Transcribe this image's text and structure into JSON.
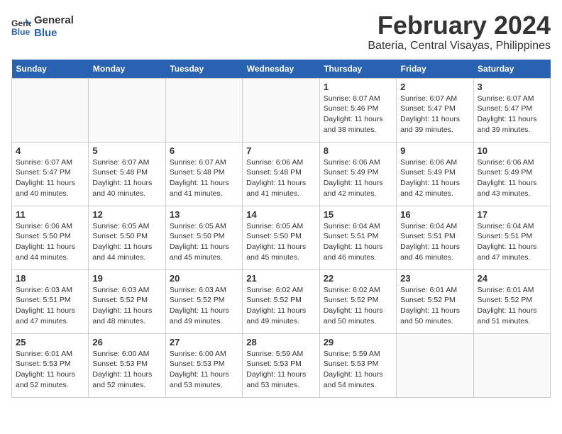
{
  "header": {
    "logo_line1": "General",
    "logo_line2": "Blue",
    "month": "February 2024",
    "location": "Bateria, Central Visayas, Philippines"
  },
  "weekdays": [
    "Sunday",
    "Monday",
    "Tuesday",
    "Wednesday",
    "Thursday",
    "Friday",
    "Saturday"
  ],
  "weeks": [
    [
      {
        "day": "",
        "sunrise": "",
        "sunset": "",
        "daylight": ""
      },
      {
        "day": "",
        "sunrise": "",
        "sunset": "",
        "daylight": ""
      },
      {
        "day": "",
        "sunrise": "",
        "sunset": "",
        "daylight": ""
      },
      {
        "day": "",
        "sunrise": "",
        "sunset": "",
        "daylight": ""
      },
      {
        "day": "1",
        "sunrise": "Sunrise: 6:07 AM",
        "sunset": "Sunset: 5:46 PM",
        "daylight": "Daylight: 11 hours and 38 minutes."
      },
      {
        "day": "2",
        "sunrise": "Sunrise: 6:07 AM",
        "sunset": "Sunset: 5:47 PM",
        "daylight": "Daylight: 11 hours and 39 minutes."
      },
      {
        "day": "3",
        "sunrise": "Sunrise: 6:07 AM",
        "sunset": "Sunset: 5:47 PM",
        "daylight": "Daylight: 11 hours and 39 minutes."
      }
    ],
    [
      {
        "day": "4",
        "sunrise": "Sunrise: 6:07 AM",
        "sunset": "Sunset: 5:47 PM",
        "daylight": "Daylight: 11 hours and 40 minutes."
      },
      {
        "day": "5",
        "sunrise": "Sunrise: 6:07 AM",
        "sunset": "Sunset: 5:48 PM",
        "daylight": "Daylight: 11 hours and 40 minutes."
      },
      {
        "day": "6",
        "sunrise": "Sunrise: 6:07 AM",
        "sunset": "Sunset: 5:48 PM",
        "daylight": "Daylight: 11 hours and 41 minutes."
      },
      {
        "day": "7",
        "sunrise": "Sunrise: 6:06 AM",
        "sunset": "Sunset: 5:48 PM",
        "daylight": "Daylight: 11 hours and 41 minutes."
      },
      {
        "day": "8",
        "sunrise": "Sunrise: 6:06 AM",
        "sunset": "Sunset: 5:49 PM",
        "daylight": "Daylight: 11 hours and 42 minutes."
      },
      {
        "day": "9",
        "sunrise": "Sunrise: 6:06 AM",
        "sunset": "Sunset: 5:49 PM",
        "daylight": "Daylight: 11 hours and 42 minutes."
      },
      {
        "day": "10",
        "sunrise": "Sunrise: 6:06 AM",
        "sunset": "Sunset: 5:49 PM",
        "daylight": "Daylight: 11 hours and 43 minutes."
      }
    ],
    [
      {
        "day": "11",
        "sunrise": "Sunrise: 6:06 AM",
        "sunset": "Sunset: 5:50 PM",
        "daylight": "Daylight: 11 hours and 44 minutes."
      },
      {
        "day": "12",
        "sunrise": "Sunrise: 6:05 AM",
        "sunset": "Sunset: 5:50 PM",
        "daylight": "Daylight: 11 hours and 44 minutes."
      },
      {
        "day": "13",
        "sunrise": "Sunrise: 6:05 AM",
        "sunset": "Sunset: 5:50 PM",
        "daylight": "Daylight: 11 hours and 45 minutes."
      },
      {
        "day": "14",
        "sunrise": "Sunrise: 6:05 AM",
        "sunset": "Sunset: 5:50 PM",
        "daylight": "Daylight: 11 hours and 45 minutes."
      },
      {
        "day": "15",
        "sunrise": "Sunrise: 6:04 AM",
        "sunset": "Sunset: 5:51 PM",
        "daylight": "Daylight: 11 hours and 46 minutes."
      },
      {
        "day": "16",
        "sunrise": "Sunrise: 6:04 AM",
        "sunset": "Sunset: 5:51 PM",
        "daylight": "Daylight: 11 hours and 46 minutes."
      },
      {
        "day": "17",
        "sunrise": "Sunrise: 6:04 AM",
        "sunset": "Sunset: 5:51 PM",
        "daylight": "Daylight: 11 hours and 47 minutes."
      }
    ],
    [
      {
        "day": "18",
        "sunrise": "Sunrise: 6:03 AM",
        "sunset": "Sunset: 5:51 PM",
        "daylight": "Daylight: 11 hours and 47 minutes."
      },
      {
        "day": "19",
        "sunrise": "Sunrise: 6:03 AM",
        "sunset": "Sunset: 5:52 PM",
        "daylight": "Daylight: 11 hours and 48 minutes."
      },
      {
        "day": "20",
        "sunrise": "Sunrise: 6:03 AM",
        "sunset": "Sunset: 5:52 PM",
        "daylight": "Daylight: 11 hours and 49 minutes."
      },
      {
        "day": "21",
        "sunrise": "Sunrise: 6:02 AM",
        "sunset": "Sunset: 5:52 PM",
        "daylight": "Daylight: 11 hours and 49 minutes."
      },
      {
        "day": "22",
        "sunrise": "Sunrise: 6:02 AM",
        "sunset": "Sunset: 5:52 PM",
        "daylight": "Daylight: 11 hours and 50 minutes."
      },
      {
        "day": "23",
        "sunrise": "Sunrise: 6:01 AM",
        "sunset": "Sunset: 5:52 PM",
        "daylight": "Daylight: 11 hours and 50 minutes."
      },
      {
        "day": "24",
        "sunrise": "Sunrise: 6:01 AM",
        "sunset": "Sunset: 5:52 PM",
        "daylight": "Daylight: 11 hours and 51 minutes."
      }
    ],
    [
      {
        "day": "25",
        "sunrise": "Sunrise: 6:01 AM",
        "sunset": "Sunset: 5:53 PM",
        "daylight": "Daylight: 11 hours and 52 minutes."
      },
      {
        "day": "26",
        "sunrise": "Sunrise: 6:00 AM",
        "sunset": "Sunset: 5:53 PM",
        "daylight": "Daylight: 11 hours and 52 minutes."
      },
      {
        "day": "27",
        "sunrise": "Sunrise: 6:00 AM",
        "sunset": "Sunset: 5:53 PM",
        "daylight": "Daylight: 11 hours and 53 minutes."
      },
      {
        "day": "28",
        "sunrise": "Sunrise: 5:59 AM",
        "sunset": "Sunset: 5:53 PM",
        "daylight": "Daylight: 11 hours and 53 minutes."
      },
      {
        "day": "29",
        "sunrise": "Sunrise: 5:59 AM",
        "sunset": "Sunset: 5:53 PM",
        "daylight": "Daylight: 11 hours and 54 minutes."
      },
      {
        "day": "",
        "sunrise": "",
        "sunset": "",
        "daylight": ""
      },
      {
        "day": "",
        "sunrise": "",
        "sunset": "",
        "daylight": ""
      }
    ]
  ]
}
